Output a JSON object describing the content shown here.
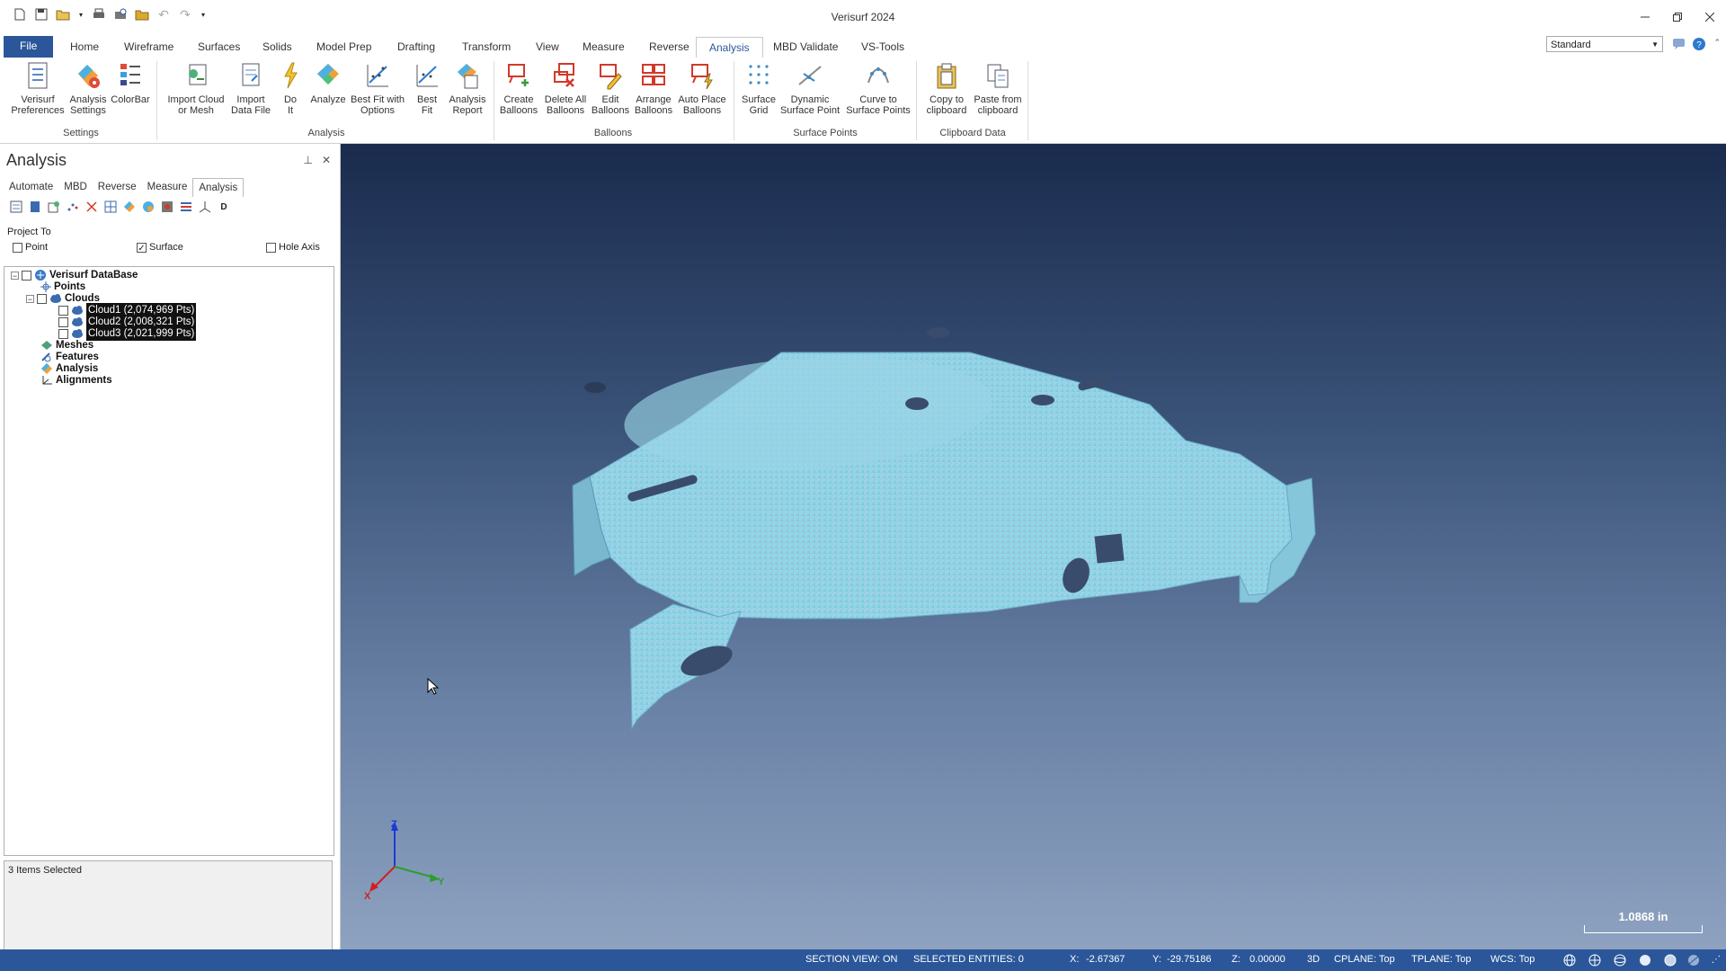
{
  "app": {
    "title": "Verisurf 2024"
  },
  "ribbon_tabs": [
    {
      "label": "File"
    },
    {
      "label": "Home"
    },
    {
      "label": "Wireframe"
    },
    {
      "label": "Surfaces"
    },
    {
      "label": "Solids"
    },
    {
      "label": "Model Prep"
    },
    {
      "label": "Drafting"
    },
    {
      "label": "Transform"
    },
    {
      "label": "View"
    },
    {
      "label": "Measure"
    },
    {
      "label": "Reverse"
    },
    {
      "label": "Analysis"
    },
    {
      "label": "MBD Validate"
    },
    {
      "label": "VS-Tools"
    }
  ],
  "active_tab": "Analysis",
  "workspace_select": {
    "value": "Standard"
  },
  "ribbon_groups": [
    {
      "label": "Settings",
      "buttons": [
        {
          "label": "Verisurf\nPreferences",
          "icon": "preferences-icon"
        },
        {
          "label": "Analysis\nSettings",
          "icon": "analysis-settings-icon"
        },
        {
          "label": "ColorBar",
          "icon": "colorbar-icon"
        }
      ]
    },
    {
      "label": "Analysis",
      "buttons": [
        {
          "label": "Import Cloud\nor Mesh",
          "icon": "import-cloud-icon"
        },
        {
          "label": "Import\nData File",
          "icon": "import-data-icon"
        },
        {
          "label": "Do\nIt",
          "icon": "do-it-icon"
        },
        {
          "label": "Analyze",
          "icon": "analyze-icon"
        },
        {
          "label": "Best Fit with\nOptions",
          "icon": "best-fit-options-icon"
        },
        {
          "label": "Best\nFit",
          "icon": "best-fit-icon"
        },
        {
          "label": "Analysis\nReport",
          "icon": "analysis-report-icon"
        }
      ]
    },
    {
      "label": "Balloons",
      "buttons": [
        {
          "label": "Create\nBalloons",
          "icon": "create-balloons-icon"
        },
        {
          "label": "Delete All\nBalloons",
          "icon": "delete-balloons-icon"
        },
        {
          "label": "Edit\nBalloons",
          "icon": "edit-balloons-icon"
        },
        {
          "label": "Arrange\nBalloons",
          "icon": "arrange-balloons-icon"
        },
        {
          "label": "Auto Place\nBalloons",
          "icon": "auto-place-balloons-icon"
        }
      ]
    },
    {
      "label": "Surface Points",
      "buttons": [
        {
          "label": "Surface\nGrid",
          "icon": "surface-grid-icon"
        },
        {
          "label": "Dynamic\nSurface Point",
          "icon": "dynamic-surface-point-icon"
        },
        {
          "label": "Curve to\nSurface Points",
          "icon": "curve-to-surface-icon"
        }
      ]
    },
    {
      "label": "Clipboard Data",
      "buttons": [
        {
          "label": "Copy to\nclipboard",
          "icon": "copy-icon"
        },
        {
          "label": "Paste from\nclipboard",
          "icon": "paste-icon"
        }
      ]
    }
  ],
  "panel": {
    "title": "Analysis",
    "tabs": [
      {
        "label": "Automate"
      },
      {
        "label": "MBD"
      },
      {
        "label": "Reverse"
      },
      {
        "label": "Measure"
      },
      {
        "label": "Analysis"
      }
    ],
    "project_to": {
      "label": "Project To",
      "options": [
        {
          "label": "Point",
          "checked": false
        },
        {
          "label": "Surface",
          "checked": true
        },
        {
          "label": "Hole Axis",
          "checked": false
        }
      ]
    },
    "tree": {
      "root": "Verisurf DataBase",
      "points": "Points",
      "clouds": "Clouds",
      "cloud_items": [
        "Cloud1 (2,074,969 Pts)",
        "Cloud2 (2,008,321 Pts)",
        "Cloud3 (2,021,999 Pts)"
      ],
      "meshes": "Meshes",
      "features": "Features",
      "analysis": "Analysis",
      "alignments": "Alignments"
    },
    "selection_info": "3 Items Selected"
  },
  "viewport": {
    "scale_label": "1.0868 in",
    "axes": {
      "x": "X",
      "y": "Y",
      "z": "Z"
    }
  },
  "status_bar": {
    "section_view": "SECTION VIEW: ON",
    "selected_entities": "SELECTED ENTITIES: 0",
    "x_label": "X:",
    "x_value": "-2.67367",
    "y_label": "Y:",
    "y_value": "-29.75186",
    "z_label": "Z:",
    "z_value": "0.00000",
    "mode": "3D",
    "cplane": "CPLANE: Top",
    "tplane": "TPLANE: Top",
    "wcs": "WCS: Top"
  },
  "colors": {
    "accent": "#2b579a",
    "status_bg": "#2b579a",
    "cloud_surface": "#7fd6e0"
  }
}
